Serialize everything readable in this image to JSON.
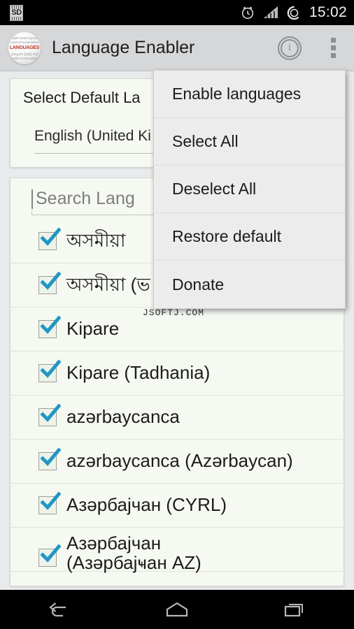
{
  "status_bar": {
    "sd_icon_label": "SD",
    "sd_icon_name": "sd-card-icon",
    "alarm_icon_name": "alarm-clock-icon",
    "signal_icon_name": "signal-bars-icon",
    "battery_icon_name": "battery-circle-icon",
    "time": "15:02"
  },
  "action_bar": {
    "logo_word": "LANGUAGES",
    "logo_cloud": {
      "line1": "english  deutsch  русский",
      "line2": "español  français  italiano",
      "line3": "português  日本語  中文",
      "line4": "polski  svenska  türkçe"
    },
    "title": "Language Enabler",
    "info_label": "i",
    "info_name": "info-icon",
    "overflow_name": "overflow-menu-icon"
  },
  "default_language_card": {
    "label": "Select Default La",
    "selected_value": "English (United Ki"
  },
  "search": {
    "placeholder": "Search Lang",
    "value": ""
  },
  "languages": [
    {
      "name": "অসমীয়া",
      "checked": true
    },
    {
      "name": "অসমীয়া (ভ",
      "checked": true
    },
    {
      "name": "Kipare",
      "checked": true
    },
    {
      "name": "Kipare (Tadhania)",
      "checked": true
    },
    {
      "name": "azərbaycanca",
      "checked": true
    },
    {
      "name": "azərbaycanca (Azərbaycan)",
      "checked": true
    },
    {
      "name": "Азәрбајчан (CYRL)",
      "checked": true
    },
    {
      "name": "Азәрбајчан (Азәрбајҹан AZ)",
      "checked": true
    }
  ],
  "popup_menu": {
    "items": [
      {
        "label": "Enable languages"
      },
      {
        "label": "Select All"
      },
      {
        "label": "Deselect All"
      },
      {
        "label": "Restore default"
      },
      {
        "label": "Donate"
      }
    ]
  },
  "watermark": "JSOFTJ.COM",
  "nav_bar": {
    "back_name": "back-button",
    "home_name": "home-button",
    "recents_name": "recents-button"
  },
  "colors": {
    "accent_checkbox": "#2196c4",
    "card_bg": "#f5f9f2",
    "action_bar_bg": "#d6d7d9",
    "menu_bg": "#ececec",
    "logo_word": "#c0392b"
  }
}
